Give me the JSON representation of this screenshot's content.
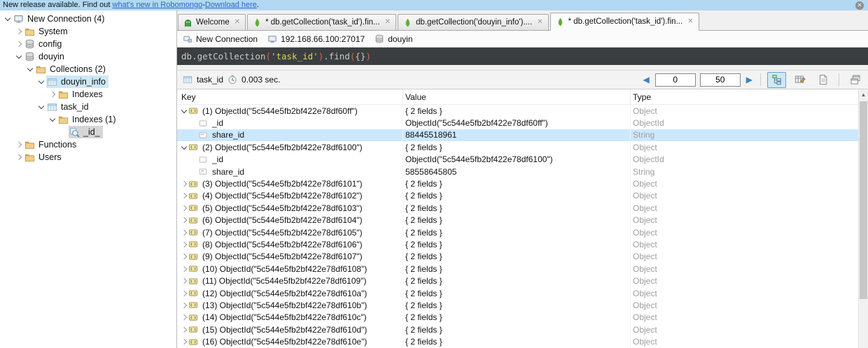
{
  "banner": {
    "text1": "New release available. Find out ",
    "link1": "what's new in Robomongo",
    "sep": " - ",
    "link2": "Download here",
    "text2": "."
  },
  "colors": {
    "banner_bg": "#b2d8f2",
    "selection_blue": "#cce8ff",
    "tree_selection_gray": "#d6d6d6",
    "tree_selection_blue": "#cde8f6",
    "query_bg": "#3b3e40",
    "query_string": "#d9d162",
    "query_paren": "#cf6a4c",
    "mongo_green": "#6cb33f",
    "pager_arrow_blue": "#3f80c4",
    "type_gray": "#9e9e9e"
  },
  "sidebar": {
    "items": [
      {
        "label": "New Connection (4)",
        "level": 0,
        "arrow": "expanded",
        "icon": "connection",
        "highlight": ""
      },
      {
        "label": "System",
        "level": 1,
        "arrow": "collapsed",
        "icon": "folder",
        "highlight": ""
      },
      {
        "label": "config",
        "level": 1,
        "arrow": "collapsed",
        "icon": "database",
        "highlight": ""
      },
      {
        "label": "douyin",
        "level": 1,
        "arrow": "expanded",
        "icon": "database",
        "highlight": ""
      },
      {
        "label": "Collections (2)",
        "level": 2,
        "arrow": "expanded",
        "icon": "folder",
        "highlight": ""
      },
      {
        "label": "douyin_info",
        "level": 3,
        "arrow": "expanded",
        "icon": "collection",
        "highlight": "blue"
      },
      {
        "label": "Indexes",
        "level": 4,
        "arrow": "collapsed",
        "icon": "folder",
        "highlight": ""
      },
      {
        "label": "task_id",
        "level": 3,
        "arrow": "expanded",
        "icon": "collection",
        "highlight": ""
      },
      {
        "label": "Indexes (1)",
        "level": 4,
        "arrow": "expanded",
        "icon": "folder",
        "highlight": ""
      },
      {
        "label": "_id_",
        "level": 5,
        "arrow": "none",
        "icon": "index",
        "highlight": "gray"
      },
      {
        "label": "Functions",
        "level": 1,
        "arrow": "collapsed",
        "icon": "folder",
        "highlight": ""
      },
      {
        "label": "Users",
        "level": 1,
        "arrow": "collapsed",
        "icon": "folder",
        "highlight": ""
      }
    ]
  },
  "tabs": [
    {
      "label": "Welcome",
      "icon": "robomongo",
      "active": false
    },
    {
      "label": "* db.getCollection('task_id').fin...",
      "icon": "leaf",
      "active": false
    },
    {
      "label": "db.getCollection('douyin_info')....",
      "icon": "leaf",
      "active": false
    },
    {
      "label": "* db.getCollection('task_id').fin...",
      "icon": "leaf",
      "active": true
    }
  ],
  "connection_bar": {
    "connection": "New Connection",
    "server": "192.168.66.100:27017",
    "database": "douyin"
  },
  "query": {
    "segments": [
      {
        "text": "db.getCollection",
        "color": "default"
      },
      {
        "text": "(",
        "color": "paren"
      },
      {
        "text": "'task_id'",
        "color": "string"
      },
      {
        "text": ")",
        "color": "paren"
      },
      {
        "text": ".find",
        "color": "default"
      },
      {
        "text": "(",
        "color": "paren"
      },
      {
        "text": "{}",
        "color": "default"
      },
      {
        "text": ")",
        "color": "paren"
      }
    ]
  },
  "results_toolbar": {
    "collection": "task_id",
    "time": "0.003 sec.",
    "skip": "0",
    "limit": "50"
  },
  "grid": {
    "columns": [
      "Key",
      "Value",
      "Type"
    ],
    "rows": [
      {
        "key": "(1) ObjectId(\"5c544e5fb2bf422e78df60ff\")",
        "value": "{ 2 fields }",
        "type": "Object",
        "level": 0,
        "arrow": "expanded",
        "icon": "object",
        "selected": false
      },
      {
        "key": "_id",
        "value": "ObjectId(\"5c544e5fb2bf422e78df60ff\")",
        "type": "ObjectId",
        "level": 1,
        "arrow": "none",
        "icon": "objectid",
        "selected": false
      },
      {
        "key": "share_id",
        "value": "88445518961",
        "type": "String",
        "level": 1,
        "arrow": "none",
        "icon": "string",
        "selected": true
      },
      {
        "key": "(2) ObjectId(\"5c544e5fb2bf422e78df6100\")",
        "value": "{ 2 fields }",
        "type": "Object",
        "level": 0,
        "arrow": "expanded",
        "icon": "object",
        "selected": false
      },
      {
        "key": "_id",
        "value": "ObjectId(\"5c544e5fb2bf422e78df6100\")",
        "type": "ObjectId",
        "level": 1,
        "arrow": "none",
        "icon": "objectid",
        "selected": false
      },
      {
        "key": "share_id",
        "value": "58558645805",
        "type": "String",
        "level": 1,
        "arrow": "none",
        "icon": "string",
        "selected": false
      },
      {
        "key": "(3) ObjectId(\"5c544e5fb2bf422e78df6101\")",
        "value": "{ 2 fields }",
        "type": "Object",
        "level": 0,
        "arrow": "collapsed",
        "icon": "object",
        "selected": false
      },
      {
        "key": "(4) ObjectId(\"5c544e5fb2bf422e78df6102\")",
        "value": "{ 2 fields }",
        "type": "Object",
        "level": 0,
        "arrow": "collapsed",
        "icon": "object",
        "selected": false
      },
      {
        "key": "(5) ObjectId(\"5c544e5fb2bf422e78df6103\")",
        "value": "{ 2 fields }",
        "type": "Object",
        "level": 0,
        "arrow": "collapsed",
        "icon": "object",
        "selected": false
      },
      {
        "key": "(6) ObjectId(\"5c544e5fb2bf422e78df6104\")",
        "value": "{ 2 fields }",
        "type": "Object",
        "level": 0,
        "arrow": "collapsed",
        "icon": "object",
        "selected": false
      },
      {
        "key": "(7) ObjectId(\"5c544e5fb2bf422e78df6105\")",
        "value": "{ 2 fields }",
        "type": "Object",
        "level": 0,
        "arrow": "collapsed",
        "icon": "object",
        "selected": false
      },
      {
        "key": "(8) ObjectId(\"5c544e5fb2bf422e78df6106\")",
        "value": "{ 2 fields }",
        "type": "Object",
        "level": 0,
        "arrow": "collapsed",
        "icon": "object",
        "selected": false
      },
      {
        "key": "(9) ObjectId(\"5c544e5fb2bf422e78df6107\")",
        "value": "{ 2 fields }",
        "type": "Object",
        "level": 0,
        "arrow": "collapsed",
        "icon": "object",
        "selected": false
      },
      {
        "key": "(10) ObjectId(\"5c544e5fb2bf422e78df6108\")",
        "value": "{ 2 fields }",
        "type": "Object",
        "level": 0,
        "arrow": "collapsed",
        "icon": "object",
        "selected": false
      },
      {
        "key": "(11) ObjectId(\"5c544e5fb2bf422e78df6109\")",
        "value": "{ 2 fields }",
        "type": "Object",
        "level": 0,
        "arrow": "collapsed",
        "icon": "object",
        "selected": false
      },
      {
        "key": "(12) ObjectId(\"5c544e5fb2bf422e78df610a\")",
        "value": "{ 2 fields }",
        "type": "Object",
        "level": 0,
        "arrow": "collapsed",
        "icon": "object",
        "selected": false
      },
      {
        "key": "(13) ObjectId(\"5c544e5fb2bf422e78df610b\")",
        "value": "{ 2 fields }",
        "type": "Object",
        "level": 0,
        "arrow": "collapsed",
        "icon": "object",
        "selected": false
      },
      {
        "key": "(14) ObjectId(\"5c544e5fb2bf422e78df610c\")",
        "value": "{ 2 fields }",
        "type": "Object",
        "level": 0,
        "arrow": "collapsed",
        "icon": "object",
        "selected": false
      },
      {
        "key": "(15) ObjectId(\"5c544e5fb2bf422e78df610d\")",
        "value": "{ 2 fields }",
        "type": "Object",
        "level": 0,
        "arrow": "collapsed",
        "icon": "object",
        "selected": false
      },
      {
        "key": "(16) ObjectId(\"5c544e5fb2bf422e78df610e\")",
        "value": "{ 2 fields }",
        "type": "Object",
        "level": 0,
        "arrow": "collapsed",
        "icon": "object",
        "selected": false
      }
    ]
  }
}
